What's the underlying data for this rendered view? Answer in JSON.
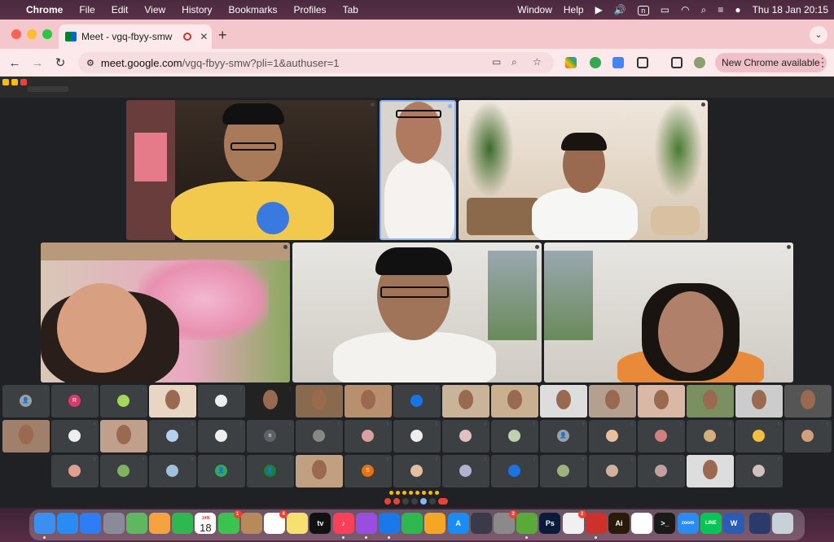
{
  "menubar": {
    "app": "Chrome",
    "items": [
      "File",
      "Edit",
      "View",
      "History",
      "Bookmarks",
      "Profiles",
      "Tab"
    ],
    "window": "Window",
    "help": "Help",
    "n_icon": "n",
    "clock": "Thu 18 Jan  20:15"
  },
  "browser": {
    "tab_title": "Meet - vgq-fbyy-smw",
    "url_host": "meet.google.com",
    "url_path": "/vgq-fbyy-smw?pli=1&authuser=1",
    "new_chrome": "New Chrome available",
    "back_icon": "arrow-left-icon",
    "forward_icon": "arrow-right-icon",
    "reload_icon": "reload-icon"
  },
  "meet": {
    "small_tiles": [
      {
        "row": 0,
        "avatar": "person",
        "color": "#9aa0a6"
      },
      {
        "row": 0,
        "avatar": "R",
        "color": "#d93a6b"
      },
      {
        "row": 0,
        "avatar": "",
        "color": "#a4d65e"
      },
      {
        "row": 0,
        "avatar": "video",
        "color": "#e8d5c4"
      },
      {
        "row": 0,
        "avatar": "",
        "color": "#eee"
      },
      {
        "row": 0,
        "avatar": "video",
        "color": "#222"
      },
      {
        "row": 0,
        "avatar": "video",
        "color": "#8a6a4e"
      },
      {
        "row": 0,
        "avatar": "video",
        "color": "#b89070"
      },
      {
        "row": 0,
        "avatar": "person",
        "color": "#1a73e8"
      },
      {
        "row": 0,
        "avatar": "video",
        "color": "#c9b49a"
      },
      {
        "row": 0,
        "avatar": "video",
        "color": "#c8b090"
      },
      {
        "row": 0,
        "avatar": "video",
        "color": "#ddd"
      },
      {
        "row": 0,
        "avatar": "video",
        "color": "#b5a090"
      },
      {
        "row": 0,
        "avatar": "video",
        "color": "#d9b8a5"
      },
      {
        "row": 0,
        "avatar": "video",
        "color": "#7a9060"
      },
      {
        "row": 0,
        "avatar": "video",
        "color": "#ccc"
      },
      {
        "row": 0,
        "avatar": "video",
        "color": "#555"
      }
    ],
    "row2_tiles": [
      {
        "avatar": "video",
        "color": "#a0806a"
      },
      {
        "avatar": "",
        "color": "#eee"
      },
      {
        "avatar": "video",
        "color": "#c0a08a"
      },
      {
        "avatar": "",
        "color": "#b7d0ef"
      },
      {
        "avatar": "",
        "color": "#eee"
      },
      {
        "avatar": "n",
        "color": "#5f6368"
      },
      {
        "avatar": "",
        "color": "#888"
      },
      {
        "avatar": "",
        "color": "#d9a0a0"
      },
      {
        "avatar": "",
        "color": "#eee"
      },
      {
        "avatar": "",
        "color": "#e0c0c0"
      },
      {
        "avatar": "",
        "color": "#c0d0b0"
      },
      {
        "avatar": "person",
        "color": "#9aa0a6"
      },
      {
        "avatar": "",
        "color": "#e8c0a0"
      },
      {
        "avatar": "",
        "color": "#d08080"
      },
      {
        "avatar": "",
        "color": "#d0b080"
      },
      {
        "avatar": "",
        "color": "#f0c040"
      },
      {
        "avatar": "",
        "color": "#d0a080"
      }
    ],
    "row3_tiles": [
      {
        "avatar": "",
        "color": "#e0a090"
      },
      {
        "avatar": "",
        "color": "#80b060"
      },
      {
        "avatar": "",
        "color": "#a0c0e0"
      },
      {
        "avatar": "person",
        "color": "#34a853"
      },
      {
        "avatar": "person",
        "color": "#188038"
      },
      {
        "avatar": "video",
        "color": "#c0a080"
      },
      {
        "avatar": "S",
        "color": "#e8710a"
      },
      {
        "avatar": "",
        "color": "#e0c0a0"
      },
      {
        "avatar": "",
        "color": "#b0b0d0"
      },
      {
        "avatar": "person",
        "color": "#1a73e8"
      },
      {
        "avatar": "",
        "color": "#a0b080"
      },
      {
        "avatar": "",
        "color": "#d0b0a0"
      },
      {
        "avatar": "",
        "color": "#c0a0a0"
      },
      {
        "avatar": "video",
        "color": "#ddd"
      },
      {
        "avatar": "",
        "color": "#d0c0c0"
      }
    ]
  },
  "dock": {
    "calendar_day": "18",
    "calendar_month": "JAN",
    "apps": [
      {
        "name": "finder-icon",
        "color": "#3c8ef0",
        "label": ""
      },
      {
        "name": "safari-icon",
        "color": "#2a8bf2",
        "label": ""
      },
      {
        "name": "mail-icon",
        "color": "#2e7cf6",
        "label": ""
      },
      {
        "name": "launchpad-icon",
        "color": "#8a8a9a",
        "label": ""
      },
      {
        "name": "maps-icon",
        "color": "#5fb85f",
        "label": ""
      },
      {
        "name": "photos-icon",
        "color": "#f4a340",
        "label": ""
      },
      {
        "name": "facetime-icon",
        "color": "#2fb84f",
        "label": ""
      },
      {
        "name": "calendar-icon",
        "color": "#ffffff",
        "label": ""
      },
      {
        "name": "messages-icon",
        "color": "#3bc34f",
        "label": "",
        "badge": "1"
      },
      {
        "name": "contacts-icon",
        "color": "#b88a5a",
        "label": ""
      },
      {
        "name": "reminders-icon",
        "color": "#ffffff",
        "label": "",
        "badge": "4"
      },
      {
        "name": "notes-icon",
        "color": "#f8e070",
        "label": ""
      },
      {
        "name": "appletv-icon",
        "color": "#111111",
        "label": "tv"
      },
      {
        "name": "music-icon",
        "color": "#f9405a",
        "label": "♪"
      },
      {
        "name": "podcasts-icon",
        "color": "#9a4ee0",
        "label": ""
      },
      {
        "name": "keynote-icon",
        "color": "#1a78e8",
        "label": ""
      },
      {
        "name": "numbers-icon",
        "color": "#2fb84f",
        "label": ""
      },
      {
        "name": "pages-icon",
        "color": "#f5a623",
        "label": ""
      },
      {
        "name": "appstore-icon",
        "color": "#1a8cf5",
        "label": "A"
      },
      {
        "name": "quicktime-icon",
        "color": "#3a3a4a",
        "label": ""
      },
      {
        "name": "settings-icon",
        "color": "#8a8a8a",
        "label": "",
        "badge": "2"
      },
      {
        "name": "utorrent-icon",
        "color": "#5aaa3a",
        "label": ""
      },
      {
        "name": "photoshop-icon",
        "color": "#0a1a3a",
        "label": "Ps"
      },
      {
        "name": "hometown-icon",
        "color": "#f0f0f0",
        "label": "",
        "badge": "2"
      },
      {
        "name": "acrobat-icon",
        "color": "#d0302a",
        "label": ""
      },
      {
        "name": "illustrator-icon",
        "color": "#2a1a0a",
        "label": "Ai"
      },
      {
        "name": "chrome-icon",
        "color": "#ffffff",
        "label": ""
      },
      {
        "name": "terminal-icon",
        "color": "#1a1a1a",
        "label": ">_"
      },
      {
        "name": "zoom-icon",
        "color": "#2a8cf0",
        "label": "zoom"
      },
      {
        "name": "line-icon",
        "color": "#06c755",
        "label": "LINE"
      },
      {
        "name": "word-icon",
        "color": "#2b5cb5",
        "label": "W"
      },
      {
        "name": "screenshot-icon",
        "color": "#2a3a6a",
        "label": ""
      },
      {
        "name": "trash-icon",
        "color": "#c8d0d8",
        "label": ""
      }
    ]
  }
}
